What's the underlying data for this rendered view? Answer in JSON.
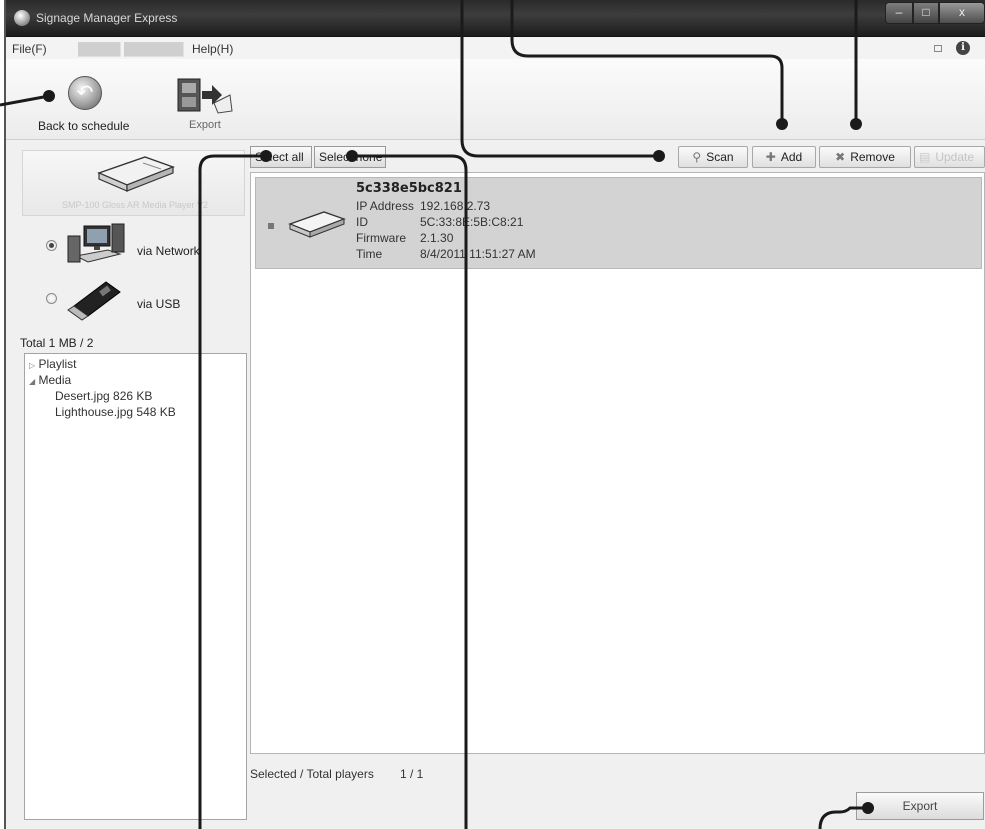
{
  "window": {
    "title": "Signage Manager Express",
    "controls": {
      "minimize": "–",
      "maximize": "□",
      "close": "x"
    }
  },
  "menu": {
    "items": [
      {
        "label": "File(F)"
      },
      {
        "label": "Help(H)"
      }
    ]
  },
  "ribbon": {
    "back_label": "Back to schedule",
    "export_label": "Export"
  },
  "left_panel": {
    "player_model": "SMP-100 Gloss AR Media Player V2",
    "via_network": "via Network",
    "via_usb": "via USB",
    "selected_source": "network",
    "total": "Total 1 MB / 2",
    "tree": {
      "playlist": "Playlist",
      "media": "Media",
      "files": [
        "Desert.jpg 826 KB",
        "Lighthouse.jpg 548 KB"
      ]
    }
  },
  "toolbar": {
    "select_all": "Select all",
    "select_none": "Select none",
    "scan": "Scan",
    "add": "Add",
    "remove": "Remove",
    "update": "Update"
  },
  "player": {
    "name": "5c338e5bc821",
    "ip_label": "IP Address",
    "ip_value": "192.168.2.73",
    "id_label": "ID",
    "id_value": "5C:33:8E:5B:C8:21",
    "firmware_label": "Firmware",
    "firmware_value": "2.1.30",
    "time_label": "Time",
    "time_value": "8/4/2011 11:51:27 AM"
  },
  "status": {
    "label": "Selected / Total players",
    "value": "1 / 1"
  },
  "footer": {
    "export_label": "Export"
  }
}
